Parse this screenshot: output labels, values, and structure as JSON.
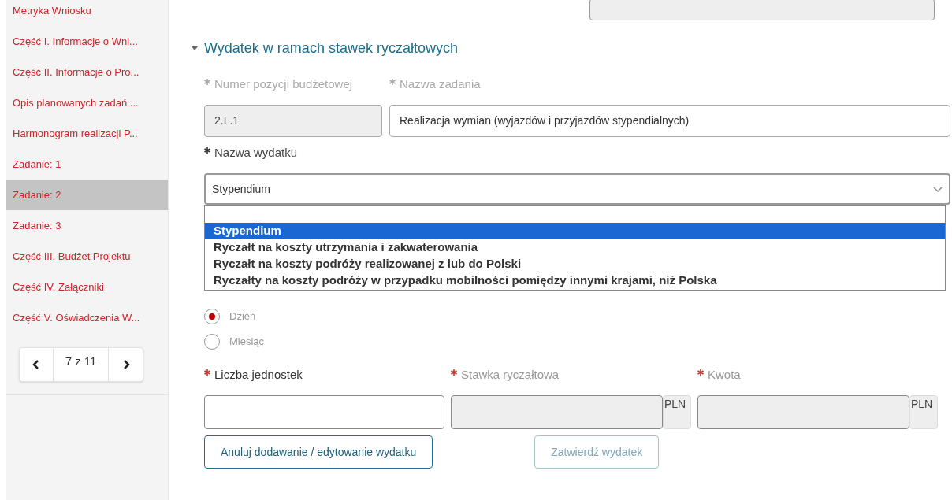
{
  "sidebar": {
    "items": [
      {
        "label": "Metryka Wniosku",
        "selected": false
      },
      {
        "label": "Część I. Informacje o Wni...",
        "selected": false
      },
      {
        "label": "Część II. Informacje o Pro...",
        "selected": false
      },
      {
        "label": "Opis planowanych zadań ...",
        "selected": false
      },
      {
        "label": "Harmonogram realizacji P...",
        "selected": false
      },
      {
        "label": "Zadanie: 1",
        "selected": false
      },
      {
        "label": "Zadanie: 2",
        "selected": true
      },
      {
        "label": "Zadanie: 3",
        "selected": false
      },
      {
        "label": "Część III. Budżet Projektu",
        "selected": false
      },
      {
        "label": "Część IV. Załączniki",
        "selected": false
      },
      {
        "label": "Część V. Oświadczenia W...",
        "selected": false
      }
    ],
    "pager": {
      "text": "7 z 11"
    }
  },
  "section": {
    "title": "Wydatek w ramach stawek ryczałtowych",
    "expanded": true
  },
  "budget_position": {
    "label": "Numer pozycji budżetowej",
    "required": true,
    "value": "2.L.1"
  },
  "task_name": {
    "label": "Nazwa zadania",
    "required": true,
    "value": "Realizacja wymian (wyjazdów i przyjazdów stypendialnych)"
  },
  "expense_name": {
    "label": "Nazwa wydatku",
    "required": true,
    "value": "Stypendium",
    "options": [
      {
        "label": "Stypendium",
        "selected": true
      },
      {
        "label": "Ryczałt na koszty utrzymania i zakwaterowania",
        "selected": false
      },
      {
        "label": "Ryczałt na koszty podróży realizowanej z lub do Polski",
        "selected": false
      },
      {
        "label": "Ryczałty na koszty podróży w przypadku mobilności pomiędzy innymi krajami, niż Polska",
        "selected": false
      }
    ]
  },
  "unit_type": {
    "options": [
      {
        "label": "Dzień",
        "selected": true
      },
      {
        "label": "Miesiąc",
        "selected": false
      }
    ]
  },
  "amounts": [
    {
      "label": "Liczba jednostek",
      "required": true,
      "disabled": false
    },
    {
      "label": "Stawka ryczałtowa",
      "required": true,
      "disabled": true,
      "suffix": "PLN"
    },
    {
      "label": "Kwota",
      "required": true,
      "disabled": true,
      "suffix": "PLN"
    }
  ],
  "buttons": [
    {
      "label": "Anuluj dodawanie / edytowanie wydatku",
      "disabled": false
    },
    {
      "label": "Zatwierdź wydatek",
      "disabled": true
    }
  ]
}
